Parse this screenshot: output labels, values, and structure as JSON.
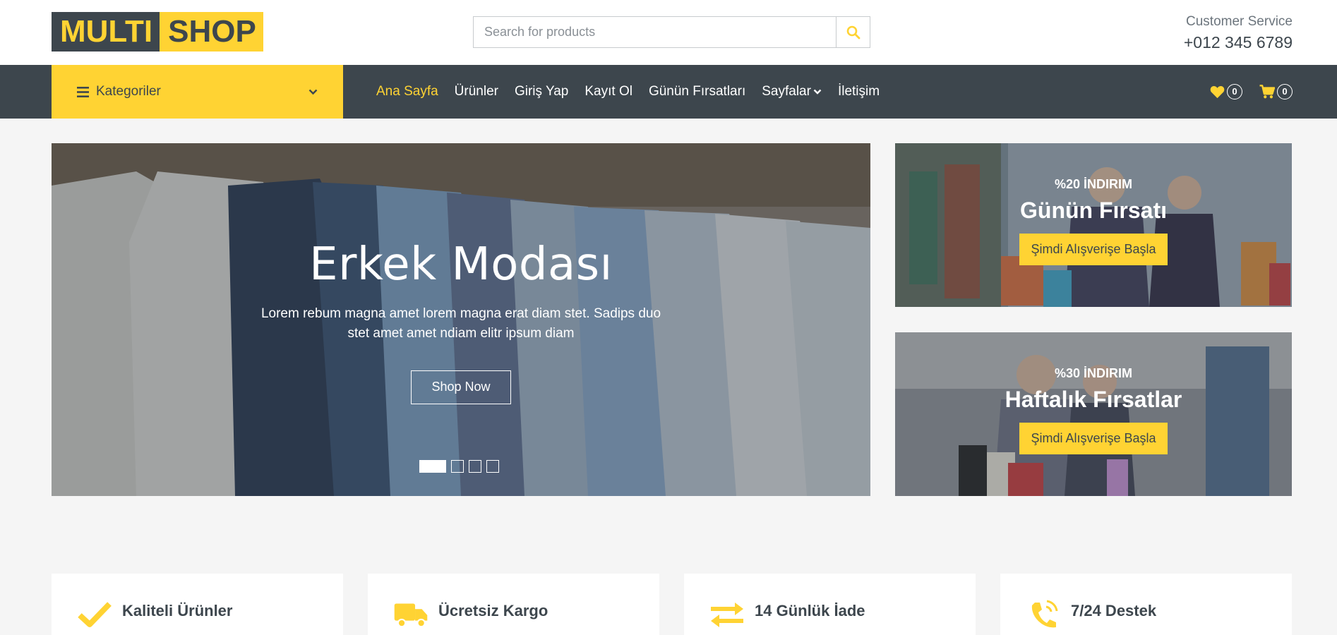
{
  "colors": {
    "primary": "#ffd333",
    "dark": "#3d464d",
    "light": "#f5f5f5"
  },
  "brand": {
    "part1": "MULTI",
    "part2": "SHOP"
  },
  "search": {
    "placeholder": "Search for products",
    "icon": "search-icon"
  },
  "contact": {
    "label": "Customer Service",
    "phone": "+012 345 6789"
  },
  "categories": {
    "label": "Kategoriler",
    "icon": "bars-icon"
  },
  "nav": {
    "items": [
      {
        "label": "Ana Sayfa"
      },
      {
        "label": "Ürünler"
      },
      {
        "label": "Giriş Yap"
      },
      {
        "label": "Kayıt Ol"
      },
      {
        "label": "Günün Fırsatları"
      },
      {
        "label": "Sayfalar"
      },
      {
        "label": "İletişim"
      }
    ],
    "active": "Ana Sayfa",
    "wishlist_count": "0",
    "cart_count": "0"
  },
  "hero": {
    "title": "Erkek Modası",
    "description": "Lorem rebum magna amet lorem magna erat diam stet. Sadips duo stet amet amet ndiam elitr ipsum diam",
    "button": "Shop Now",
    "slides": 4,
    "active_slide": 1
  },
  "offers": [
    {
      "discount": "%20 İNDIRIM",
      "title": "Günün Fırsatı",
      "button": "Şimdi Alışverişe Başla"
    },
    {
      "discount": "%30 İNDIRIM",
      "title": "Haftalık Fırsatlar",
      "button": "Şimdi Alışverişe Başla"
    }
  ],
  "features": [
    {
      "label": "Kaliteli Ürünler",
      "icon": "check-icon"
    },
    {
      "label": "Ücretsiz Kargo",
      "icon": "truck-icon"
    },
    {
      "label": "14 Günlük İade",
      "icon": "exchange-icon"
    },
    {
      "label": "7/24 Destek",
      "icon": "phone-icon"
    }
  ]
}
